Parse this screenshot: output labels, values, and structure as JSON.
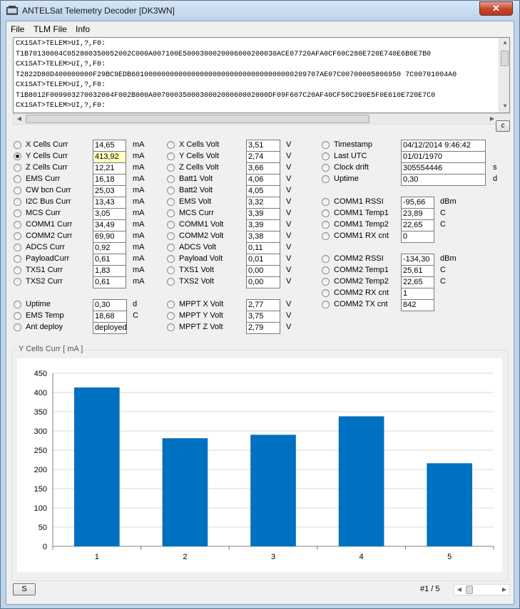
{
  "window": {
    "title": "ANTELSat Telemetry Decoder [DK3WN]",
    "close_glyph": "✕"
  },
  "menu": [
    "File",
    "TLM File",
    "Info"
  ],
  "log_lines": [
    "CX1SAT>TELEM>UI,?,F0:",
    "T1B70130004C052800350052002C000A007100E5000300020006000200030ACE07720AFA0CF60C280E720E740E6B0E7B0",
    "CX1SAT>TELEM>UI,?,F0:",
    "T2822D80D400000000F29BC9EDB60100000000000000000000000000000000000209707AE07C00700005806950 7C00701004A0",
    "CX1SAT>TELEM>UI,?,F0:",
    "T1B8012F009903270032004F002B000A007000350003000200060002000DF09F607C20AF40CF50C290E5F0E610E720E7C0",
    "CX1SAT>TELEM>UI,?,F0:"
  ],
  "c_button": "c",
  "col1": [
    {
      "label": "X Cells Curr",
      "value": "14,65",
      "unit": "mA",
      "checked": false
    },
    {
      "label": "Y Cells Curr",
      "value": "413,92",
      "unit": "mA",
      "checked": true
    },
    {
      "label": "Z Cells Curr",
      "value": "12,21",
      "unit": "mA",
      "checked": false
    },
    {
      "label": "EMS Curr",
      "value": "16,18",
      "unit": "mA",
      "checked": false
    },
    {
      "label": "CW bcn Curr",
      "value": "25,03",
      "unit": "mA",
      "checked": false
    },
    {
      "label": "I2C Bus Curr",
      "value": "13,43",
      "unit": "mA",
      "checked": false
    },
    {
      "label": "MCS Curr",
      "value": "3,05",
      "unit": "mA",
      "checked": false
    },
    {
      "label": "COMM1 Curr",
      "value": "34,49",
      "unit": "mA",
      "checked": false
    },
    {
      "label": "COMM2 Curr",
      "value": "69,90",
      "unit": "mA",
      "checked": false
    },
    {
      "label": "ADCS Curr",
      "value": "0,92",
      "unit": "mA",
      "checked": false
    },
    {
      "label": "PayloadCurr",
      "value": "0,61",
      "unit": "mA",
      "checked": false
    },
    {
      "label": "TXS1 Curr",
      "value": "1,83",
      "unit": "mA",
      "checked": false
    },
    {
      "label": "TXS2 Curr",
      "value": "0,61",
      "unit": "mA",
      "checked": false
    }
  ],
  "col1b": [
    {
      "label": "Uptime",
      "value": "0,30",
      "unit": "d"
    },
    {
      "label": "EMS Temp",
      "value": "18,68",
      "unit": "C"
    },
    {
      "label": "Ant deploy",
      "value": "deployed",
      "unit": ""
    }
  ],
  "col2": [
    {
      "label": "X Cells Volt",
      "value": "3,51",
      "unit": "V"
    },
    {
      "label": "Y Cells Volt",
      "value": "2,74",
      "unit": "V"
    },
    {
      "label": "Z Cells Volt",
      "value": "3,66",
      "unit": "V"
    },
    {
      "label": "Batt1 Volt",
      "value": "4,06",
      "unit": "V"
    },
    {
      "label": "Batt2 Volt",
      "value": "4,05",
      "unit": "V"
    },
    {
      "label": "EMS Volt",
      "value": "3,32",
      "unit": "V"
    },
    {
      "label": "MCS Curr",
      "value": "3,39",
      "unit": "V"
    },
    {
      "label": "COMM1 Volt",
      "value": "3,39",
      "unit": "V"
    },
    {
      "label": "COMM2 Volt",
      "value": "3,38",
      "unit": "V"
    },
    {
      "label": "ADCS Volt",
      "value": "0,11",
      "unit": "V"
    },
    {
      "label": "Payload Volt",
      "value": "0,01",
      "unit": "V"
    },
    {
      "label": "TXS1 Volt",
      "value": "0,00",
      "unit": "V"
    },
    {
      "label": "TXS2 Volt",
      "value": "0,00",
      "unit": "V"
    }
  ],
  "col2b": [
    {
      "label": "MPPT X Volt",
      "value": "2,77",
      "unit": "V"
    },
    {
      "label": "MPPT Y Volt",
      "value": "3,75",
      "unit": "V"
    },
    {
      "label": "MPPT Z Volt",
      "value": "2,79",
      "unit": "V"
    }
  ],
  "col3a": [
    {
      "label": "Timestamp",
      "value": "04/12/2014 9:46:42",
      "unit": ""
    },
    {
      "label": "Last UTC",
      "value": "01/01/1970",
      "unit": ""
    },
    {
      "label": "Clock drift",
      "value": "305554446",
      "unit": "s"
    },
    {
      "label": "Uptime",
      "value": "0,30",
      "unit": "d"
    }
  ],
  "col3b": [
    {
      "label": "COMM1 RSSI",
      "value": "-95,66",
      "unit": "dBm"
    },
    {
      "label": "COMM1 Temp1",
      "value": "23,89",
      "unit": "C"
    },
    {
      "label": "COMM1 Temp2",
      "value": "22,65",
      "unit": "C"
    },
    {
      "label": "COMM1 RX cnt",
      "value": "0",
      "unit": ""
    }
  ],
  "col3c": [
    {
      "label": "COMM2 RSSI",
      "value": "-134,30",
      "unit": "dBm"
    },
    {
      "label": "COMM2 Temp1",
      "value": "25,61",
      "unit": "C"
    },
    {
      "label": "COMM2 Temp2",
      "value": "22,65",
      "unit": "C"
    },
    {
      "label": "COMM2 RX cnt",
      "value": "1",
      "unit": ""
    },
    {
      "label": "COMM2 TX cnt",
      "value": "842",
      "unit": ""
    }
  ],
  "chart_group_title": "Y Cells Curr  [ mA ]",
  "chart_data": {
    "type": "bar",
    "categories": [
      "1",
      "2",
      "3",
      "4",
      "5"
    ],
    "values": [
      413,
      281,
      290,
      338,
      216
    ],
    "ylim": [
      0,
      450
    ],
    "yticks": [
      0,
      50,
      100,
      150,
      200,
      250,
      300,
      350,
      400,
      450
    ],
    "grid": true,
    "bar_color": "#0070c0"
  },
  "footer": {
    "s_button": "S",
    "page_indicator": "#1 / 5"
  }
}
